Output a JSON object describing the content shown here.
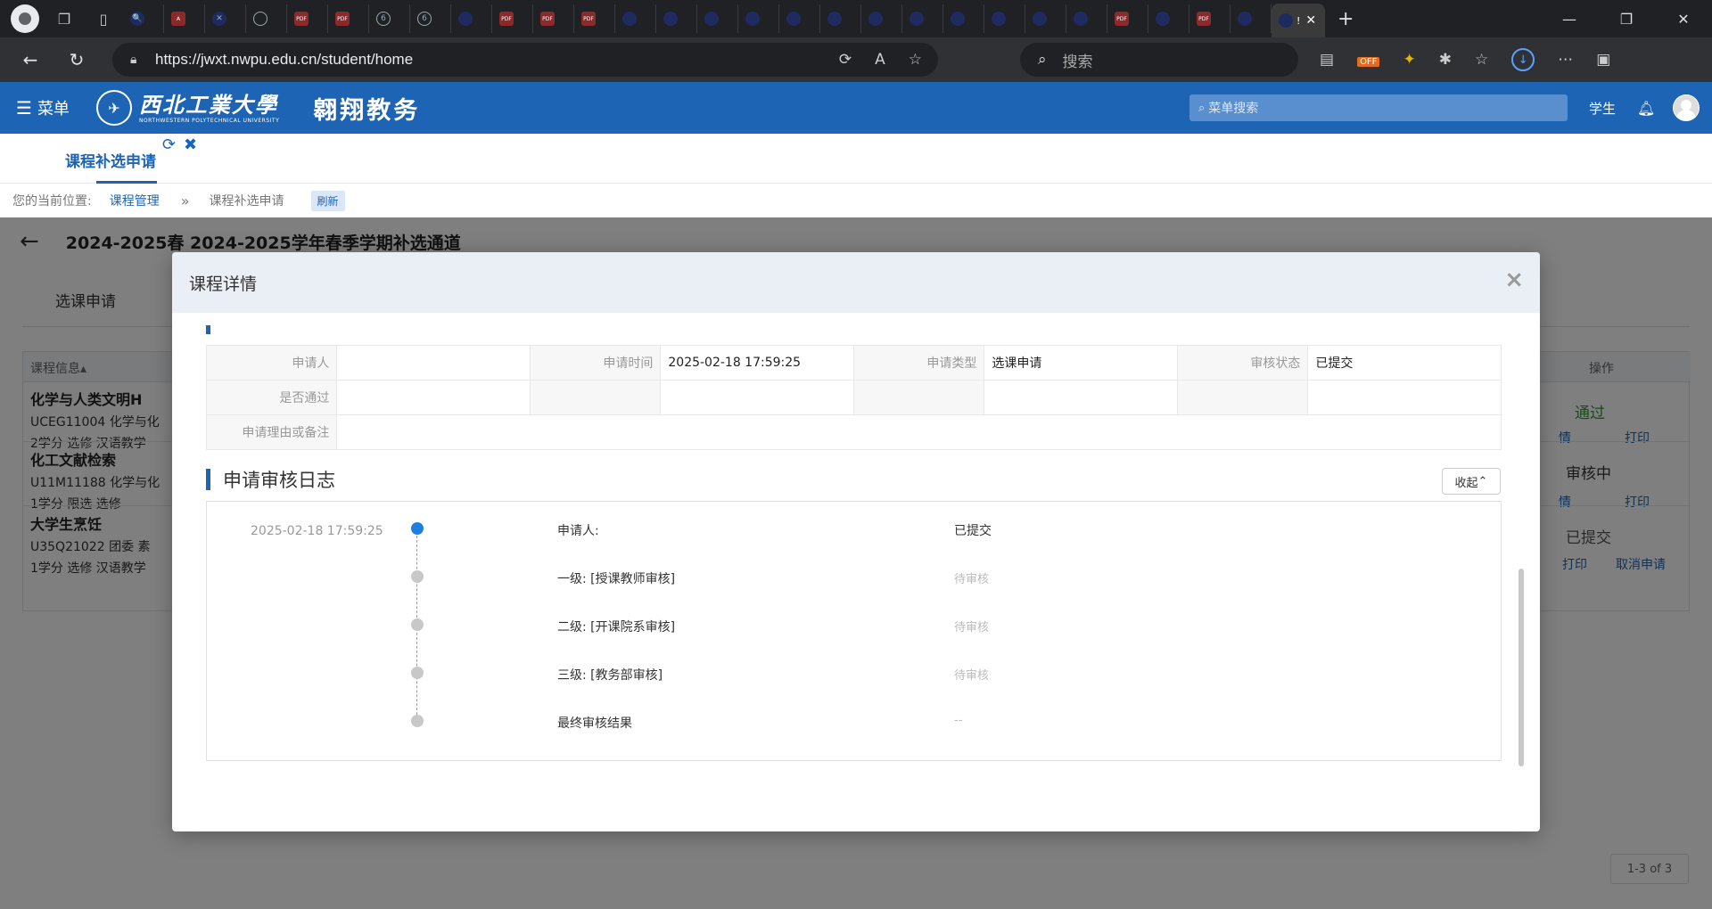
{
  "browser": {
    "tabs": [
      {
        "icon": "search-icon",
        "glyph": "🔍",
        "type": "dark"
      },
      {
        "icon": "pdf-icon",
        "glyph": "A",
        "type": "pdf"
      },
      {
        "icon": "x-icon",
        "glyph": "✕",
        "type": "dark"
      },
      {
        "icon": "globe-icon",
        "glyph": "",
        "type": "globe"
      },
      {
        "icon": "pdf-icon",
        "glyph": "PDF",
        "type": "pdf"
      },
      {
        "icon": "pdf-icon",
        "glyph": "PDF",
        "type": "pdf"
      },
      {
        "icon": "spiral-icon",
        "glyph": "6",
        "type": "globe"
      },
      {
        "icon": "spiral-icon",
        "glyph": "6",
        "type": "globe"
      },
      {
        "icon": "dark-site-icon",
        "glyph": "",
        "type": "dark"
      },
      {
        "icon": "pdf-icon",
        "glyph": "PDF",
        "type": "pdf"
      },
      {
        "icon": "pdf-icon",
        "glyph": "PDF",
        "type": "pdf"
      },
      {
        "icon": "pdf-icon",
        "glyph": "PDF",
        "type": "pdf"
      },
      {
        "icon": "dark-site-icon",
        "glyph": "",
        "type": "dark"
      },
      {
        "icon": "dark-site-icon",
        "glyph": "",
        "type": "dark"
      },
      {
        "icon": "dark-site-icon",
        "glyph": "",
        "type": "dark"
      },
      {
        "icon": "dark-site-icon",
        "glyph": "",
        "type": "dark"
      },
      {
        "icon": "dark-site-icon",
        "glyph": "",
        "type": "dark"
      },
      {
        "icon": "dark-site-icon",
        "glyph": "",
        "type": "dark"
      },
      {
        "icon": "dark-site-icon",
        "glyph": "",
        "type": "dark"
      },
      {
        "icon": "dark-site-icon",
        "glyph": "",
        "type": "dark"
      },
      {
        "icon": "dark-site-icon",
        "glyph": "",
        "type": "dark"
      },
      {
        "icon": "dark-site-icon",
        "glyph": "",
        "type": "dark"
      },
      {
        "icon": "dark-site-icon",
        "glyph": "",
        "type": "dark"
      },
      {
        "icon": "dark-site-icon",
        "glyph": "",
        "type": "dark"
      },
      {
        "icon": "pdf-icon",
        "glyph": "PDF",
        "type": "pdf"
      },
      {
        "icon": "dark-site-icon",
        "glyph": "",
        "type": "dark"
      },
      {
        "icon": "pdf-icon",
        "glyph": "PDF",
        "type": "pdf"
      },
      {
        "icon": "dark-site-icon",
        "glyph": "",
        "type": "dark"
      }
    ],
    "active_tab_label": "!",
    "url": "https://jwxt.nwpu.edu.cn/student/home",
    "search_placeholder": "搜索",
    "ext_off_badge": "OFF"
  },
  "header": {
    "menu_label": "菜单",
    "logo_cn": "西北工業大學",
    "logo_en": "NORTHWESTERN POLYTECHNICAL UNIVERSITY",
    "app_name": "翱翔教务",
    "menu_search_placeholder": "菜单搜索",
    "user_role": "学生"
  },
  "page_tab": {
    "label": "课程补选申请"
  },
  "breadcrumb": {
    "label": "您的当前位置:",
    "link": "课程管理",
    "current": "课程补选申请",
    "refresh": "刷新"
  },
  "content": {
    "title": "2024-2025春 2024-2025学年春季学期补选通道",
    "sub_tab": "选课申请",
    "col_info": "课程信息",
    "col_op": "操作",
    "courses": [
      {
        "name": "化学与人类文明H",
        "code": "UCEG11004  化学与化",
        "meta": "2学分  选修  汉语教学"
      },
      {
        "name": "化工文献检索",
        "code": "U11M11188  化学与化",
        "meta": "1学分  限选  选修"
      },
      {
        "name": "大学生烹饪",
        "code": "U35Q21022  团委  素",
        "meta": "1学分  选修  汉语教学"
      }
    ],
    "ops": [
      {
        "status": "通过",
        "color": "#2e9a2e",
        "links": [
          "情",
          "打印"
        ]
      },
      {
        "status": "审核中",
        "color": "#333333",
        "links": [
          "情",
          "打印"
        ]
      },
      {
        "status": "已提交",
        "color": "#555555",
        "links": [
          "打印",
          "取消申请"
        ]
      }
    ],
    "pager": "1-3 of 3"
  },
  "modal": {
    "title": "课程详情",
    "detail": {
      "applicant_label": "申请人",
      "applicant_value": "",
      "time_label": "申请时间",
      "time_value": "2025-02-18 17:59:25",
      "type_label": "申请类型",
      "type_value": "选课申请",
      "status_label": "审核状态",
      "status_value": "已提交",
      "passed_label": "是否通过",
      "passed_value": "",
      "reason_label": "申请理由或备注",
      "reason_value": ""
    },
    "log": {
      "title": "申请审核日志",
      "collapse_label": "收起",
      "time": "2025-02-18 17:59:25",
      "steps": [
        {
          "label": "申请人:",
          "status": "已提交",
          "state": "done"
        },
        {
          "label": "一级: [授课教师审核]",
          "status": "待审核",
          "state": "wait"
        },
        {
          "label": "二级: [开课院系审核]",
          "status": "待审核",
          "state": "wait"
        },
        {
          "label": "三级: [教务部审核]",
          "status": "待审核",
          "state": "wait"
        },
        {
          "label": "最终审核结果",
          "status": "--",
          "state": "wait"
        }
      ]
    }
  }
}
